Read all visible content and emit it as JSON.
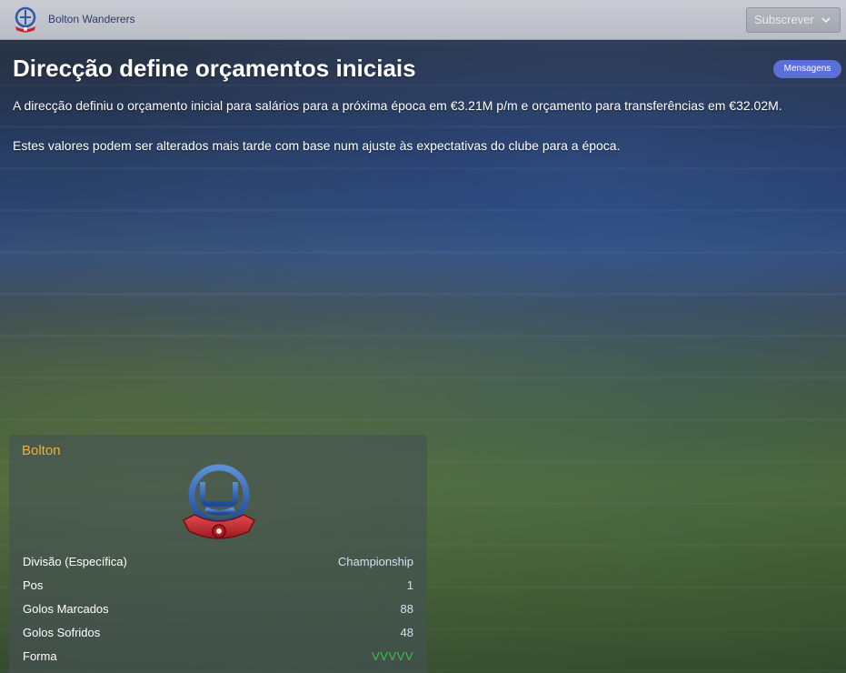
{
  "header": {
    "club_name": "Bolton Wanderers",
    "subscribe_label": "Subscrever"
  },
  "message": {
    "title": "Direcção define orçamentos iniciais",
    "tag": "Mensagens",
    "paragraphs": [
      "A direcção definiu o orçamento inicial para salários para a próxima época em €3.21M p/m e orçamento para transferências em €32.02M.",
      "Estes valores podem ser alterados mais tarde com base num ajuste às expectativas do clube para a época."
    ]
  },
  "club_panel": {
    "title": "Bolton",
    "stats": [
      {
        "label": "Divisão (Específica)",
        "value": "Championship"
      },
      {
        "label": "Pos",
        "value": "1"
      },
      {
        "label": "Golos Marcados",
        "value": "88"
      },
      {
        "label": "Golos Sofridos",
        "value": "48"
      },
      {
        "label": "Forma",
        "value": "VVVVV"
      }
    ]
  },
  "colors": {
    "panel_title": "#e6b33a",
    "form_win": "#3cbf55",
    "badge": "#5b6fd8"
  },
  "icons": {
    "small_crest": "club-crest-icon",
    "dropdown": "chevron-down-icon",
    "large_crest": "club-crest-icon"
  }
}
